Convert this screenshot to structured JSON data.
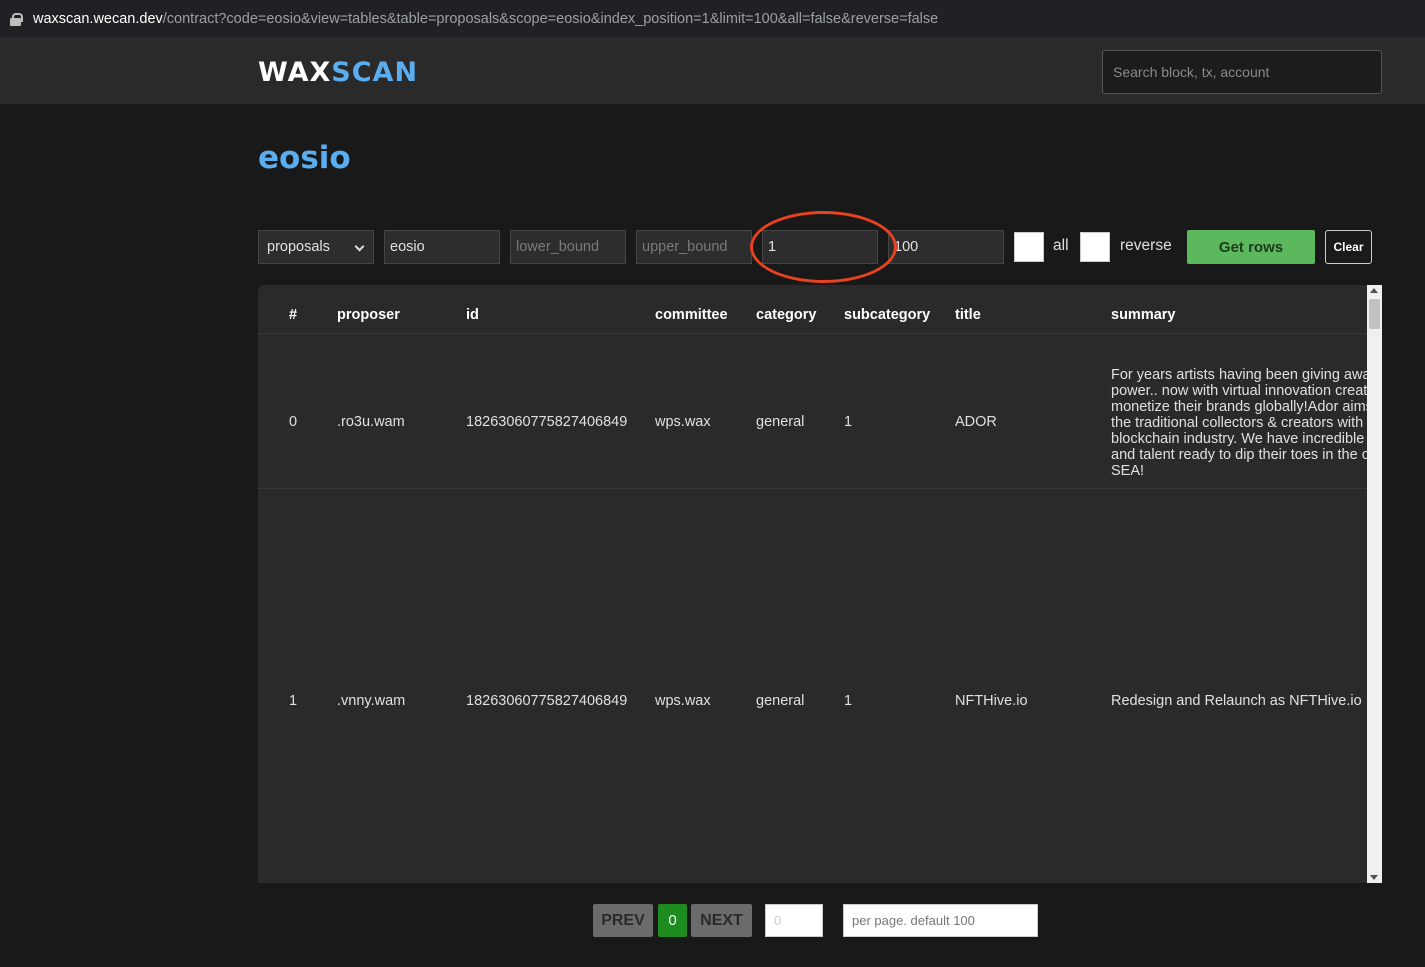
{
  "browser": {
    "url_host": "waxscan.wecan.dev",
    "url_path": "/contract?code=eosio&view=tables&table=proposals&scope=eosio&index_position=1&limit=100&all=false&reverse=false"
  },
  "header": {
    "logo_part1": "WAX",
    "logo_part2": "SCAN",
    "search_placeholder": "Search block, tx, account"
  },
  "page": {
    "title": "eosio"
  },
  "controls": {
    "table_select": "proposals",
    "scope_value": "eosio",
    "lower_bound_placeholder": "lower_bound",
    "upper_bound_placeholder": "upper_bound",
    "index_position_value": "1",
    "limit_value": "100",
    "all_label": "all",
    "reverse_label": "reverse",
    "get_rows_label": "Get rows",
    "clear_label": "Clear"
  },
  "table": {
    "headers": [
      "#",
      "proposer",
      "id",
      "committee",
      "category",
      "subcategory",
      "title",
      "summary"
    ],
    "rows": [
      {
        "index": "0",
        "proposer": ".ro3u.wam",
        "id": "18263060775827406849",
        "committee": "wps.wax",
        "category": "general",
        "subcategory": "1",
        "title": "ADOR",
        "summary_lines": [
          "For years artists having been giving away",
          "power.. now with virtual innovation creativ",
          "monetize their brands globally!Ador aims",
          "the traditional collectors & creators with t",
          "blockchain industry. We have incredible re",
          "and talent ready to dip their toes in the cry",
          "SEA!"
        ]
      },
      {
        "index": "1",
        "proposer": ".vnny.wam",
        "id": "18263060775827406849",
        "committee": "wps.wax",
        "category": "general",
        "subcategory": "1",
        "title": "NFTHive.io",
        "summary": "Redesign and Relaunch as NFTHive.io"
      }
    ]
  },
  "pagination": {
    "prev_label": "PREV",
    "current_page": "0",
    "next_label": "NEXT",
    "page_input_placeholder": "0",
    "per_page_placeholder": "per page. default 100"
  },
  "colors": {
    "accent_blue": "#5aaef0",
    "get_rows_green": "#5cb85c",
    "page_green": "#1e8c1e",
    "annotation_red": "#e8421e"
  }
}
